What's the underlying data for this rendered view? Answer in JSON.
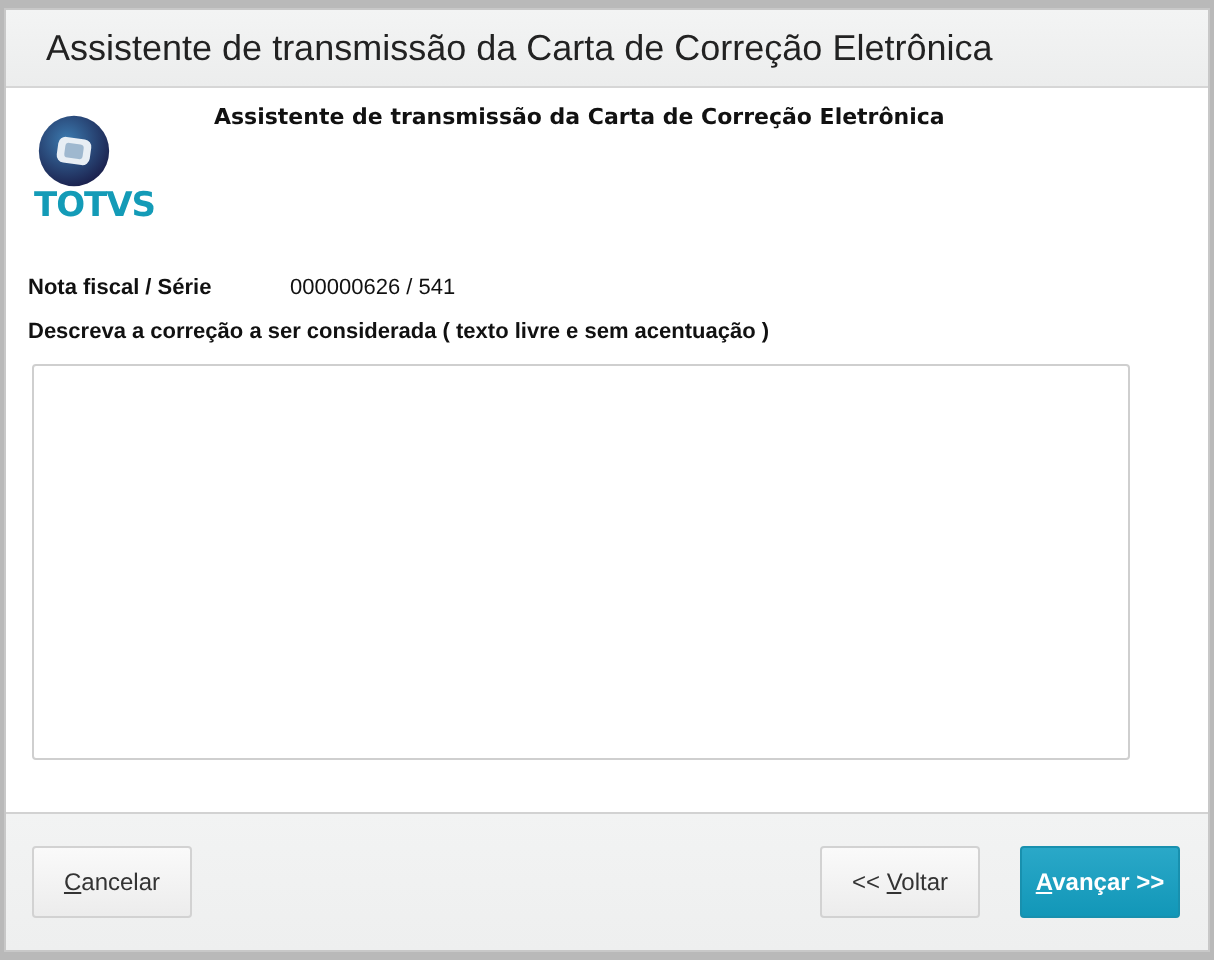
{
  "window": {
    "title": "Assistente de transmissão da Carta de Correção Eletrônica"
  },
  "header": {
    "logo_text": "TOTVS",
    "heading": "Assistente de transmissão da Carta de Correção Eletrônica"
  },
  "invoice": {
    "label": "Nota fiscal / Série",
    "value": "000000626 / 541"
  },
  "correction": {
    "label": "Descreva a correção a ser considerada ( texto livre e sem acentuação )"
  },
  "buttons": [
    {
      "kind": "secondary",
      "label_parts": [
        {
          "text": "C",
          "underlined": true
        },
        {
          "text": "ancelar",
          "underlined": false
        }
      ]
    },
    {
      "kind": "secondary",
      "label_parts": [
        {
          "text": "<< ",
          "underlined": false
        },
        {
          "text": "V",
          "underlined": true
        },
        {
          "text": "oltar",
          "underlined": false
        }
      ]
    },
    {
      "kind": "primary",
      "label_parts": [
        {
          "text": "A",
          "underlined": true
        },
        {
          "text": "vançar >>",
          "underlined": false
        }
      ]
    }
  ]
}
